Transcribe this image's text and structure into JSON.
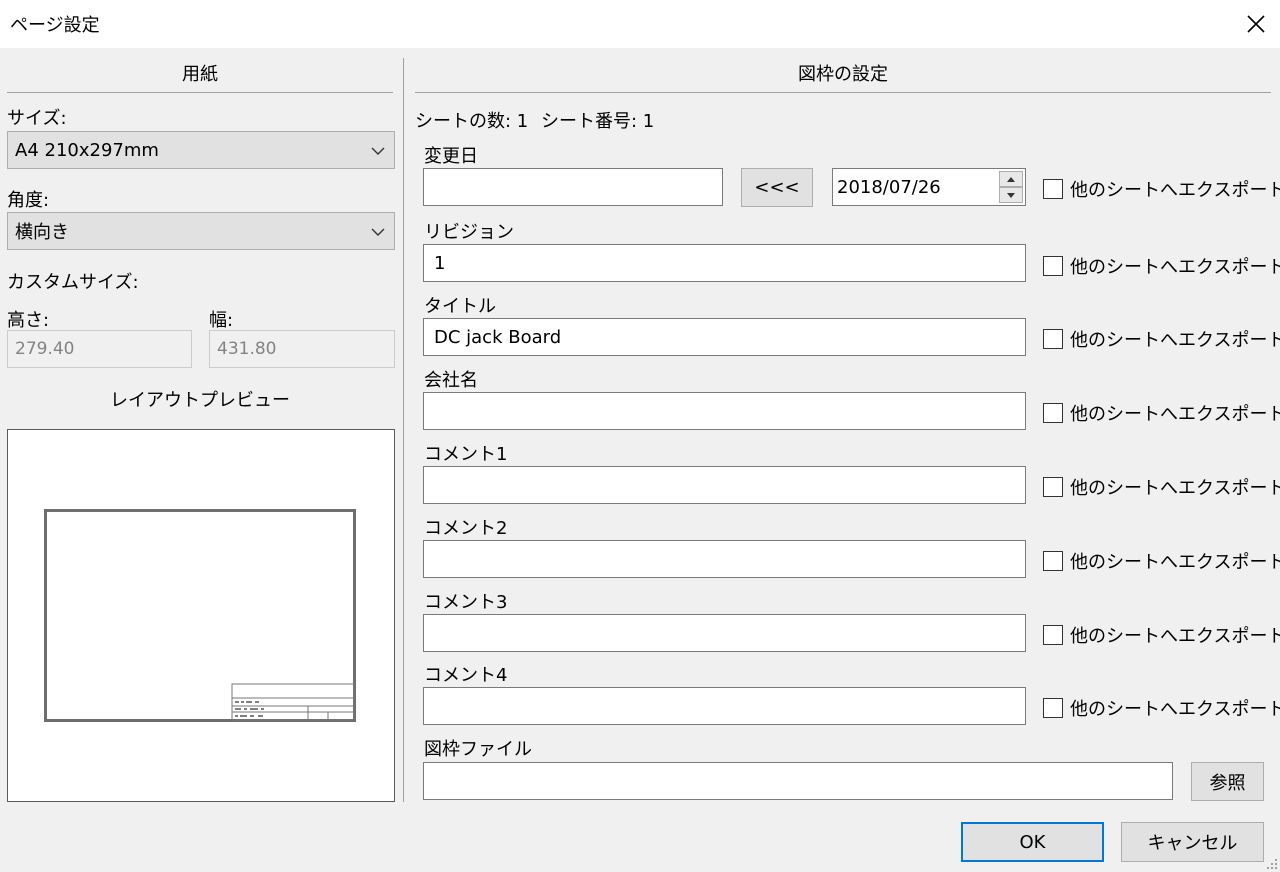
{
  "window": {
    "title": "ページ設定"
  },
  "paper": {
    "heading": "用紙",
    "size_label": "サイズ:",
    "size_value": "A4 210x297mm",
    "orientation_label": "角度:",
    "orientation_value": "横向き",
    "custom_size_label": "カスタムサイズ:",
    "height_label": "高さ:",
    "height_value": "279.40",
    "width_label": "幅:",
    "width_value": "431.80",
    "preview_label": "レイアウトプレビュー"
  },
  "title_block": {
    "heading": "図枠の設定",
    "sheet_count": "シートの数: 1",
    "sheet_number": "シート番号: 1",
    "export_label": "他のシートへエクスポート",
    "date_label": "変更日",
    "date_input": "",
    "copy_date_button": "<<<",
    "date_value": "2018/07/26",
    "revision_label": "リビジョン",
    "revision_value": "1",
    "title_label": "タイトル",
    "title_value": "DC jack Board",
    "company_label": "会社名",
    "company_value": "",
    "comment1_label": "コメント1",
    "comment1_value": "",
    "comment2_label": "コメント2",
    "comment2_value": "",
    "comment3_label": "コメント3",
    "comment3_value": "",
    "comment4_label": "コメント4",
    "comment4_value": "",
    "file_label": "図枠ファイル",
    "file_value": "",
    "browse_button": "参照"
  },
  "footer": {
    "ok": "OK",
    "cancel": "キャンセル"
  },
  "colors": {
    "accent": "#0078d7",
    "dialog_bg": "#f0f0f0",
    "button_bg": "#e1e1e1"
  }
}
